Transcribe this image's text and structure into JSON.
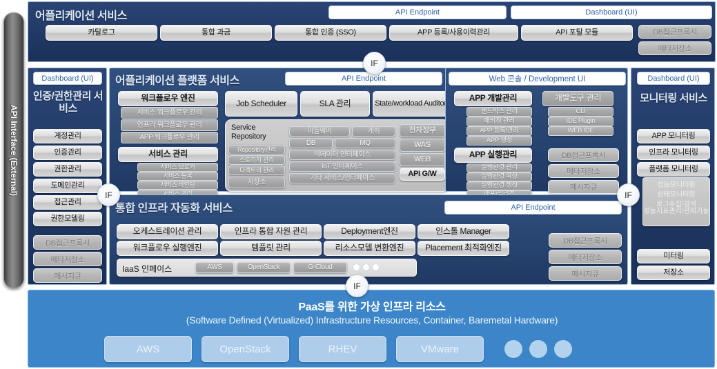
{
  "left_bar": {
    "label": "API Interface (External)"
  },
  "app_service": {
    "title": "어플리케이션 서비스",
    "endpoints": [
      "API Endpoint",
      "Dashboard (UI)"
    ],
    "modules": [
      "카탈로그",
      "통합 과금",
      "통합 인증 (SSO)",
      "APP 등록/사용이력관리",
      "API 포탈 모듈"
    ],
    "side_modules": [
      "DB접근프록시",
      "메타저장소"
    ]
  },
  "auth_service": {
    "dashboard": "Dashboard (UI)",
    "title": "인증/권한관리 서비스",
    "modules": [
      "계정관리",
      "인증관리",
      "권한관리",
      "도메인관리",
      "접근관리",
      "권한모델링"
    ],
    "side_modules": [
      "DB접근프록시",
      "메타저장소",
      "메시지큐"
    ]
  },
  "platform_service": {
    "title": "어플리케이션 플랫폼 서비스",
    "endpoint": "API Endpoint",
    "workflow_engine": {
      "title": "워크플로우 엔진",
      "items": [
        "서비스 워크플로우 관리",
        "인프라 워크플로우 관리",
        "APP 워크플로우 관리"
      ]
    },
    "service_mgmt": {
      "title": "서비스 관리",
      "items": [
        "서비스 브로커",
        "서비스 등록",
        "서비스 바인딩",
        "서비스 관리"
      ]
    },
    "job_scheduler": "Job Scheduler",
    "sla": "SLA 관리",
    "state_auditor": "State/workload Auditor",
    "service_repository": {
      "title": "Service Repository",
      "items": [
        "Repository관리",
        "스토리지 관리",
        "디렉토리 관리",
        "저장소"
      ]
    },
    "interfaces": {
      "col1": [
        "미들웨어",
        "DB",
        "빅데이터 인터페이스",
        "IoT 인터페이스",
        "기타 서비스/인터페이스"
      ],
      "col1b": [
        "캐쉬",
        "MQ"
      ],
      "col2": [
        "전자정부",
        "WAS",
        "WEB",
        "API G/W"
      ]
    }
  },
  "web_console": {
    "title": "Web 콘솔 / Development UI",
    "app_dev": {
      "title": "APP 개발관리",
      "items": [
        "샌드박스 관리",
        "패키징 관리",
        "APP 등록/관리",
        "APP 생성"
      ]
    },
    "dev_tools": {
      "title": "개발도구 관리",
      "items": [
        "CLI",
        "IDE Plugin",
        "WEB IDE"
      ]
    },
    "app_run": {
      "title": "APP 실행관리",
      "items": [
        "실행환경 관리",
        "실행환경 확장",
        "실행환경 생성",
        "배포/릴리즈"
      ]
    },
    "side_modules": [
      "DB접근프록시",
      "메타저장소",
      "메시지큐"
    ]
  },
  "monitoring": {
    "dashboard": "Dashboard (UI)",
    "title": "모니터링 서비스",
    "modules": [
      "APP 모니터링",
      "인프라 모니터링",
      "플랫폼 모니터링"
    ],
    "sub_items": [
      "성능모니터링",
      "상태모니터링",
      "로그수집/검색",
      "성능지표관리/관제기능"
    ],
    "footer_modules": [
      "미터링",
      "저장소"
    ]
  },
  "infra_service": {
    "title": "통합 인프라 자동화 서비스",
    "endpoint": "API Endpoint",
    "row1": [
      "오케스트레이션 관리",
      "인프라 통합 자원 관리",
      "Deployment엔진",
      "인스톨 Manager"
    ],
    "row2": [
      "워크플로우 실행엔진",
      "템플릿 관리",
      "리소스모델 변환엔진",
      "Placement 최적화엔진"
    ],
    "iaas_label": "IaaS 인페이스",
    "iaas_providers": [
      "AWS",
      "OpenStack",
      "G-Cloud"
    ],
    "side_modules": [
      "DB접근프록시",
      "메타저장소",
      "메시지큐"
    ]
  },
  "paas": {
    "title": "PaaS를 위한 가상 인프라 리소스",
    "subtitle": "(Software Defined (Virtualized) Infrastructure Resources, Container, Baremetal Hardware)",
    "providers": [
      "AWS",
      "OpenStack",
      "RHEV",
      "VMware"
    ]
  },
  "if_labels": {
    "a": "IF",
    "b": "IF",
    "c": "IF",
    "d": "IF"
  },
  "colors": {
    "navy": "#243d6b",
    "panel_blue": "#2d4c7d",
    "paas_blue": "#3b85c8",
    "endpoint_text": "#2f62b0",
    "title_text": "#dce8f7"
  }
}
